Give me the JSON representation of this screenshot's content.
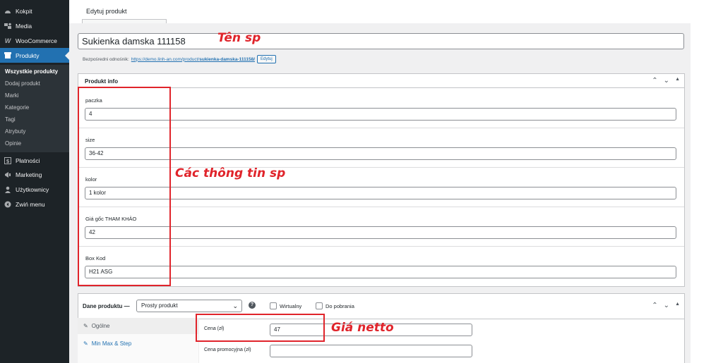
{
  "sidebar": {
    "items": [
      {
        "label": "Kokpit",
        "icon": "dashboard-icon"
      },
      {
        "label": "Media",
        "icon": "media-icon"
      },
      {
        "label": "WooCommerce",
        "icon": "woocommerce-icon"
      },
      {
        "label": "Produkty",
        "icon": "products-icon",
        "active": true
      },
      {
        "label": "Płatności",
        "icon": "payments-icon"
      },
      {
        "label": "Marketing",
        "icon": "marketing-icon"
      },
      {
        "label": "Użytkownicy",
        "icon": "users-icon"
      },
      {
        "label": "Zwiń menu",
        "icon": "collapse-icon"
      }
    ],
    "submenu": [
      "Wszystkie produkty",
      "Dodaj produkt",
      "Marki",
      "Kategorie",
      "Tagi",
      "Atrybuty",
      "Opinie"
    ]
  },
  "header": {
    "title": "Edytuj produkt"
  },
  "product_title": "Sukienka damska 111158",
  "permalink": {
    "label": "Bezpośredni odnośnik:",
    "url_base": "https://demo.linh-an.com/product/",
    "slug": "sukienka-damska-111158/",
    "edit_button": "Edytuj"
  },
  "product_info": {
    "title": "Produkt info",
    "fields": [
      {
        "label": "paczka",
        "value": "4"
      },
      {
        "label": "size",
        "value": "36-42"
      },
      {
        "label": "kolor",
        "value": "1 kolor"
      },
      {
        "label": "Giá gốc THAM KHẢO",
        "value": "42"
      },
      {
        "label": "Box Kod",
        "value": "H21 ASG"
      }
    ]
  },
  "product_data": {
    "label": "Dane produktu —",
    "type_select": "Prosty produkt",
    "virtual_label": "Wirtualny",
    "download_label": "Do pobrania",
    "tabs": [
      "Ogólne",
      "Min Max & Step"
    ],
    "regular_price_label": "Cena (zł)",
    "regular_price_value": "47",
    "sale_price_label": "Cena promocyjna (zł)",
    "sale_price_value": ""
  },
  "annotations": {
    "name": "Tên sp",
    "info": "Các thông tin sp",
    "price": "Giá netto",
    "color": "#e0242b"
  }
}
